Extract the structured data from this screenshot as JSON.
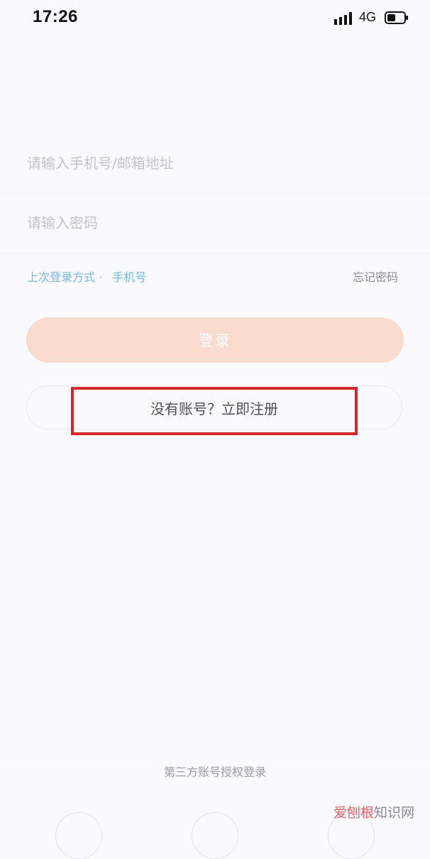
{
  "status_bar": {
    "time": "17:26",
    "network": "4G",
    "battery_level": 0.4,
    "icons": [
      "signal-bars-icon",
      "battery-icon"
    ]
  },
  "form": {
    "account_placeholder": "请输入手机号/邮箱地址",
    "password_placeholder": "请输入密码",
    "last_login_label": "上次登录方式 ·",
    "last_login_method": "手机号",
    "forgot_password": "忘记密码",
    "login_button": "登录",
    "register_link": "没有账号？立即注册"
  },
  "third_party": {
    "label": "第三方账号授权登录"
  },
  "watermark": {
    "brand_red": "爱刨根",
    "brand_gray": "知识网"
  },
  "colors": {
    "background": "#fbfafd",
    "login_button_bg": "#f9dccd",
    "link_blue": "#73b7e8",
    "highlight_red": "#d8262a"
  }
}
